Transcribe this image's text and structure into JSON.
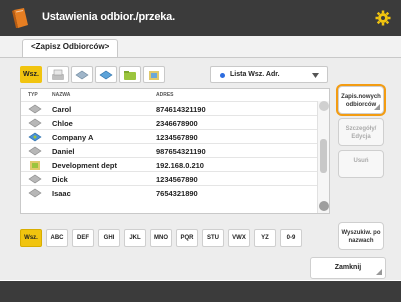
{
  "title": "Ustawienia odbior./przeka.",
  "tab": "<Zapisz Odbiorców>",
  "filter": {
    "all_label": "Wsz.",
    "icons": [
      "fax-icon",
      "email-icon",
      "ifax-icon",
      "folder-icon",
      "group-icon"
    ],
    "dropdown_label": "Lista Wsz. Adr."
  },
  "list": {
    "headers": {
      "type": "TYP",
      "name": "NAZWA",
      "address": "ADRES"
    },
    "rows": [
      {
        "icon": "fax-icon",
        "name": "Carol",
        "address": "874614321190"
      },
      {
        "icon": "fax-icon",
        "name": "Chloe",
        "address": "2346678900"
      },
      {
        "icon": "group-icon",
        "name": "Company A",
        "address": "1234567890"
      },
      {
        "icon": "fax-icon",
        "name": "Daniel",
        "address": "987654321190"
      },
      {
        "icon": "folder-icon",
        "name": "Development dept",
        "address": "192.168.0.210"
      },
      {
        "icon": "fax-icon",
        "name": "Dick",
        "address": "1234567890"
      },
      {
        "icon": "fax-icon",
        "name": "Isaac",
        "address": "7654321890"
      }
    ]
  },
  "side_buttons": {
    "register": "Zapis.nowych odbiorców",
    "details": "Szczegóły/ Edycja",
    "delete": "Usuń",
    "search": "Wyszukiw. po nazwach"
  },
  "alpha": [
    "Wsz.",
    "ABC",
    "DEF",
    "GHI",
    "JKL",
    "MNO",
    "PQR",
    "STU",
    "VWX",
    "YZ",
    "0-9"
  ],
  "close_label": "Zamknij",
  "colors": {
    "accent": "#f1c40f",
    "highlight": "#f39c12",
    "titlebar": "#3b3b3b"
  }
}
